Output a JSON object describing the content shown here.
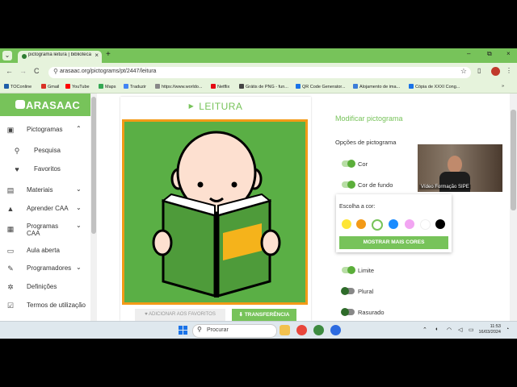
{
  "browser": {
    "tab": {
      "title": "pictograma leitura | biblioteca",
      "close": "×"
    },
    "new_tab": "+",
    "window_controls": {
      "minimize": "–",
      "restore": "⧉",
      "close": "×"
    },
    "nav": {
      "back": "←",
      "forward": "→",
      "reload": "C"
    },
    "url": "arasaac.org/pictograms/pt/2447/leitura",
    "bookmarks": [
      {
        "label": "TOConline",
        "color": "#1e5ea8"
      },
      {
        "label": "Gmail",
        "color": "#d93025"
      },
      {
        "label": "YouTube",
        "color": "#ff0000"
      },
      {
        "label": "Maps",
        "color": "#34a853"
      },
      {
        "label": "Traduzir",
        "color": "#4285f4"
      },
      {
        "label": "https://www.worldo...",
        "color": "#888888"
      },
      {
        "label": "Netflix",
        "color": "#e50914"
      },
      {
        "label": "Grátis de PNG - fun...",
        "color": "#444444"
      },
      {
        "label": "QR Code Generator...",
        "color": "#1a73e8"
      },
      {
        "label": "Alojamento de ima...",
        "color": "#3b7dd8"
      },
      {
        "label": "Cópia de XXXI Cong...",
        "color": "#1a73e8"
      }
    ]
  },
  "sidebar": {
    "logo": "ARASAAC",
    "items": [
      {
        "label": "Pictogramas",
        "icon": "image-icon",
        "chevron": "⌃"
      },
      {
        "label": "Pesquisa",
        "icon": "search-icon"
      },
      {
        "label": "Favoritos",
        "icon": "heart-icon"
      },
      {
        "label": "Materiais",
        "icon": "materials-icon",
        "chevron": "⌄"
      },
      {
        "label": "Aprender CAA",
        "icon": "graduation-icon",
        "chevron": "⌄"
      },
      {
        "label": "Programas CAA",
        "icon": "apps-icon",
        "chevron": "⌄"
      },
      {
        "label": "Aula aberta",
        "icon": "class-icon"
      },
      {
        "label": "Programadores",
        "icon": "wrench-icon",
        "chevron": "⌄"
      },
      {
        "label": "Definições",
        "icon": "gear-icon"
      },
      {
        "label": "Termos de utilização",
        "icon": "checkbox-icon"
      }
    ]
  },
  "pictogram": {
    "title": "LEITURA",
    "favorite_button": "ADICIONAR AOS FAVORITOS",
    "download_button": "TRANSFERÊNCIA"
  },
  "modify": {
    "title": "Modificar pictograma",
    "options_title": "Opções de pictograma",
    "options": [
      {
        "label": "Cor",
        "state": "on"
      },
      {
        "label": "Cor de fundo",
        "state": "on"
      },
      {
        "label": "Limite",
        "state": "on"
      },
      {
        "label": "Plural",
        "state": "off"
      },
      {
        "label": "Rasurado",
        "state": "off"
      }
    ],
    "color_picker": {
      "caption": "Escolha a cor:",
      "swatches": [
        "#fde537",
        "#f39a17",
        "#77c35a",
        "#1a8cff",
        "#f2a5f2",
        "#ffffff",
        "#000000"
      ],
      "more_button": "MOSTRAR MAIS CORES"
    }
  },
  "video": {
    "label": "Vídeo Formação SIPE"
  },
  "taskbar": {
    "search_placeholder": "Procurar",
    "time": "11:53",
    "date": "16/03/2024"
  }
}
